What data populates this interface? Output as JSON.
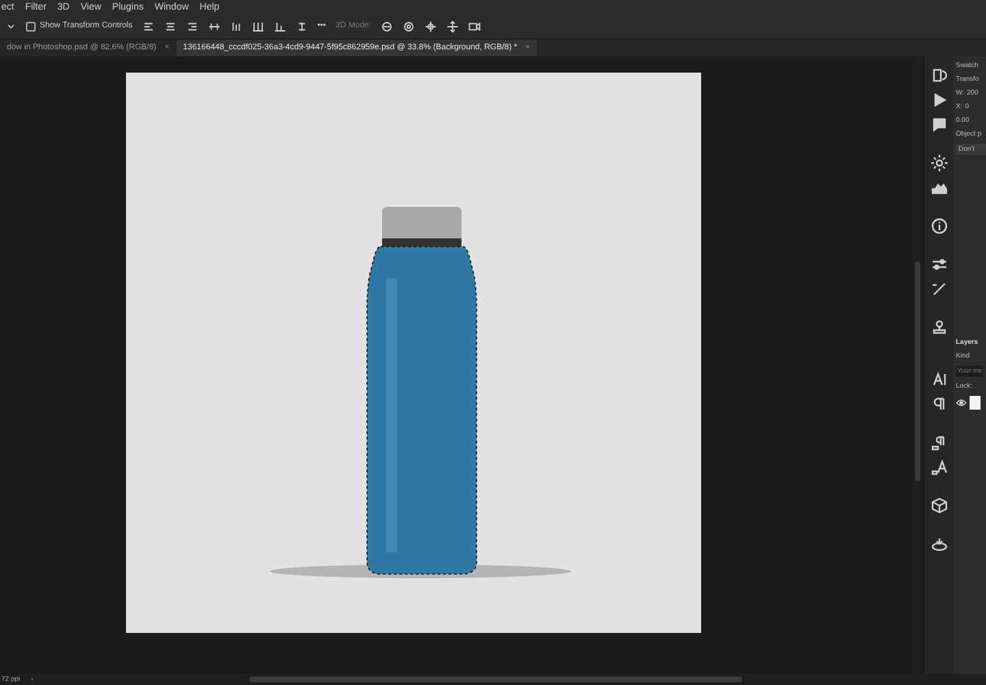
{
  "menu": [
    "ect",
    "Filter",
    "3D",
    "View",
    "Plugins",
    "Window",
    "Help"
  ],
  "options_bar": {
    "show_transform_controls": {
      "label": "Show Transform Controls",
      "checked": false
    },
    "mode_label": "3D Mode:",
    "more": "•••"
  },
  "tabs": [
    {
      "label": "dow in Photoshop.psd @ 82.6% (RGB/8)",
      "selected": false,
      "close": "×"
    },
    {
      "label": "136166448_cccdf025-36a3-4cd9-9447-5f95c862959e.psd @ 33.8% (Background, RGB/8) *",
      "selected": true,
      "close": "×"
    }
  ],
  "properties": {
    "header": "Swatch",
    "section": "Transfo",
    "w_label": "W:",
    "w_value": "200",
    "x_label": "X:",
    "x_value": "0",
    "angle_value": "0.00",
    "object_label": "Object p",
    "button": "Don't"
  },
  "layers": {
    "title": "Layers",
    "filter": "Kind",
    "search_placeholder": "Your me",
    "lock_label": "Lock:",
    "items": [
      {
        "visible": true
      }
    ]
  },
  "status_bar": {
    "resolution": "72 ppi",
    "arrow": "›"
  }
}
